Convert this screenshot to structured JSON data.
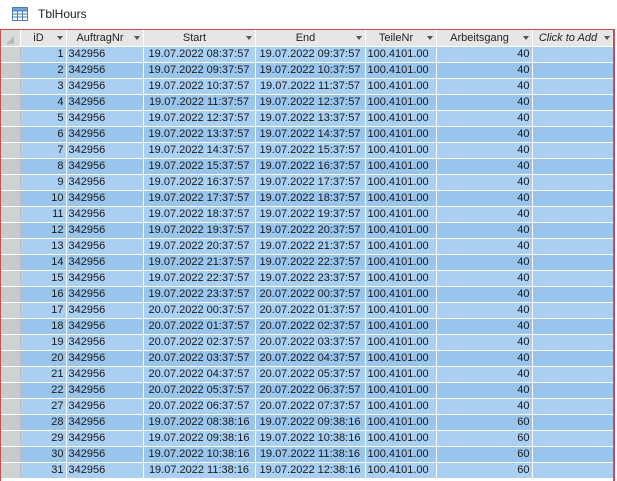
{
  "tab": {
    "title": "TblHours",
    "icon": "table-icon"
  },
  "columns": [
    {
      "key": "id",
      "label": "iD"
    },
    {
      "key": "auftragnr",
      "label": "AuftragNr"
    },
    {
      "key": "start",
      "label": "Start"
    },
    {
      "key": "end",
      "label": "End"
    },
    {
      "key": "teilenr",
      "label": "TeileNr"
    },
    {
      "key": "arbeitsgang",
      "label": "Arbeitsgang"
    },
    {
      "key": "add",
      "label": "Click to Add"
    }
  ],
  "rows": [
    {
      "id": "1",
      "auftragnr": "342956",
      "start": "19.07.2022 08:37:57",
      "end": "19.07.2022 09:37:57",
      "teilenr": "100.4101.00",
      "arbeitsgang": "40"
    },
    {
      "id": "2",
      "auftragnr": "342956",
      "start": "19.07.2022 09:37:57",
      "end": "19.07.2022 10:37:57",
      "teilenr": "100.4101.00",
      "arbeitsgang": "40"
    },
    {
      "id": "3",
      "auftragnr": "342956",
      "start": "19.07.2022 10:37:57",
      "end": "19.07.2022 11:37:57",
      "teilenr": "100.4101.00",
      "arbeitsgang": "40"
    },
    {
      "id": "4",
      "auftragnr": "342956",
      "start": "19.07.2022 11:37:57",
      "end": "19.07.2022 12:37:57",
      "teilenr": "100.4101.00",
      "arbeitsgang": "40"
    },
    {
      "id": "5",
      "auftragnr": "342956",
      "start": "19.07.2022 12:37:57",
      "end": "19.07.2022 13:37:57",
      "teilenr": "100.4101.00",
      "arbeitsgang": "40"
    },
    {
      "id": "6",
      "auftragnr": "342956",
      "start": "19.07.2022 13:37:57",
      "end": "19.07.2022 14:37:57",
      "teilenr": "100.4101.00",
      "arbeitsgang": "40"
    },
    {
      "id": "7",
      "auftragnr": "342956",
      "start": "19.07.2022 14:37:57",
      "end": "19.07.2022 15:37:57",
      "teilenr": "100.4101.00",
      "arbeitsgang": "40"
    },
    {
      "id": "8",
      "auftragnr": "342956",
      "start": "19.07.2022 15:37:57",
      "end": "19.07.2022 16:37:57",
      "teilenr": "100.4101.00",
      "arbeitsgang": "40"
    },
    {
      "id": "9",
      "auftragnr": "342956",
      "start": "19.07.2022 16:37:57",
      "end": "19.07.2022 17:37:57",
      "teilenr": "100.4101.00",
      "arbeitsgang": "40"
    },
    {
      "id": "10",
      "auftragnr": "342956",
      "start": "19.07.2022 17:37:57",
      "end": "19.07.2022 18:37:57",
      "teilenr": "100.4101.00",
      "arbeitsgang": "40"
    },
    {
      "id": "11",
      "auftragnr": "342956",
      "start": "19.07.2022 18:37:57",
      "end": "19.07.2022 19:37:57",
      "teilenr": "100.4101.00",
      "arbeitsgang": "40"
    },
    {
      "id": "12",
      "auftragnr": "342956",
      "start": "19.07.2022 19:37:57",
      "end": "19.07.2022 20:37:57",
      "teilenr": "100.4101.00",
      "arbeitsgang": "40"
    },
    {
      "id": "13",
      "auftragnr": "342956",
      "start": "19.07.2022 20:37:57",
      "end": "19.07.2022 21:37:57",
      "teilenr": "100.4101.00",
      "arbeitsgang": "40"
    },
    {
      "id": "14",
      "auftragnr": "342956",
      "start": "19.07.2022 21:37:57",
      "end": "19.07.2022 22:37:57",
      "teilenr": "100.4101.00",
      "arbeitsgang": "40"
    },
    {
      "id": "15",
      "auftragnr": "342956",
      "start": "19.07.2022 22:37:57",
      "end": "19.07.2022 23:37:57",
      "teilenr": "100.4101.00",
      "arbeitsgang": "40"
    },
    {
      "id": "16",
      "auftragnr": "342956",
      "start": "19.07.2022 23:37:57",
      "end": "20.07.2022 00:37:57",
      "teilenr": "100.4101.00",
      "arbeitsgang": "40"
    },
    {
      "id": "17",
      "auftragnr": "342956",
      "start": "20.07.2022 00:37:57",
      "end": "20.07.2022 01:37:57",
      "teilenr": "100.4101.00",
      "arbeitsgang": "40"
    },
    {
      "id": "18",
      "auftragnr": "342956",
      "start": "20.07.2022 01:37:57",
      "end": "20.07.2022 02:37:57",
      "teilenr": "100.4101.00",
      "arbeitsgang": "40"
    },
    {
      "id": "19",
      "auftragnr": "342956",
      "start": "20.07.2022 02:37:57",
      "end": "20.07.2022 03:37:57",
      "teilenr": "100.4101.00",
      "arbeitsgang": "40"
    },
    {
      "id": "20",
      "auftragnr": "342956",
      "start": "20.07.2022 03:37:57",
      "end": "20.07.2022 04:37:57",
      "teilenr": "100.4101.00",
      "arbeitsgang": "40"
    },
    {
      "id": "21",
      "auftragnr": "342956",
      "start": "20.07.2022 04:37:57",
      "end": "20.07.2022 05:37:57",
      "teilenr": "100.4101.00",
      "arbeitsgang": "40"
    },
    {
      "id": "22",
      "auftragnr": "342956",
      "start": "20.07.2022 05:37:57",
      "end": "20.07.2022 06:37:57",
      "teilenr": "100.4101.00",
      "arbeitsgang": "40"
    },
    {
      "id": "27",
      "auftragnr": "342956",
      "start": "20.07.2022 06:37:57",
      "end": "20.07.2022 07:37:57",
      "teilenr": "100.4101.00",
      "arbeitsgang": "40"
    },
    {
      "id": "28",
      "auftragnr": "342956",
      "start": "19.07.2022 08:38:16",
      "end": "19.07.2022 09:38:16",
      "teilenr": "100.4101.00",
      "arbeitsgang": "60"
    },
    {
      "id": "29",
      "auftragnr": "342956",
      "start": "19.07.2022 09:38:16",
      "end": "19.07.2022 10:38:16",
      "teilenr": "100.4101.00",
      "arbeitsgang": "60"
    },
    {
      "id": "30",
      "auftragnr": "342956",
      "start": "19.07.2022 10:38:16",
      "end": "19.07.2022 11:38:16",
      "teilenr": "100.4101.00",
      "arbeitsgang": "60"
    },
    {
      "id": "31",
      "auftragnr": "342956",
      "start": "19.07.2022 11:38:16",
      "end": "19.07.2022 12:38:16",
      "teilenr": "100.4101.00",
      "arbeitsgang": "60"
    }
  ],
  "colors": {
    "row": "#a9d0f3",
    "row_alt": "#99c5ec",
    "frame": "#c6504e",
    "header": "#e6e6e6"
  }
}
